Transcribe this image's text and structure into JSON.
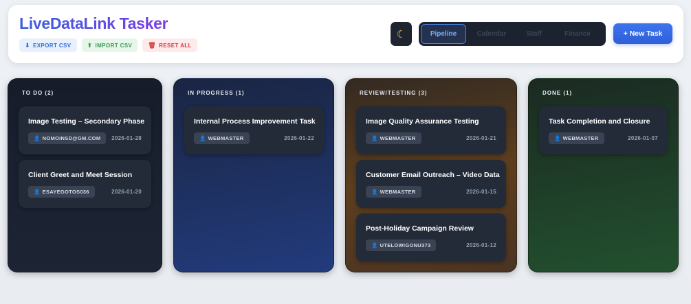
{
  "app": {
    "title": "LiveDataLink Tasker"
  },
  "toolbar": {
    "export": {
      "icon": "download-icon",
      "glyph": "⬇",
      "label": "EXPORT CSV"
    },
    "import": {
      "icon": "upload-icon",
      "glyph": "⬆",
      "label": "IMPORT CSV"
    },
    "reset": {
      "icon": "trash-icon",
      "glyph": "🗑",
      "label": "RESET ALL"
    },
    "theme_glyph": "☾",
    "new_task": "+ New Task"
  },
  "tabs": [
    {
      "label": "Pipeline",
      "active": true
    },
    {
      "label": "Calendar",
      "active": false
    },
    {
      "label": "Staff",
      "active": false
    },
    {
      "label": "Finance",
      "active": false
    }
  ],
  "user_glyph": "👤",
  "columns": [
    {
      "title": "TO DO (2)",
      "cards": [
        {
          "title": "Image Testing – Secondary Phase",
          "assignee": "NOMOINSD@GM.COM",
          "date": "2026-01-28"
        },
        {
          "title": "Client Greet and Meet Session",
          "assignee": "ESAYEGOTOS036",
          "date": "2026-01-20"
        }
      ]
    },
    {
      "title": "IN PROGRESS (1)",
      "cards": [
        {
          "title": "Internal Process Improvement Task",
          "assignee": "WEBMASTER",
          "date": "2026-01-22"
        }
      ]
    },
    {
      "title": "REVIEW/TESTING (3)",
      "cards": [
        {
          "title": "Image Quality Assurance Testing",
          "assignee": "WEBMASTER",
          "date": "2026-01-21"
        },
        {
          "title": "Customer Email Outreach – Video Data",
          "assignee": "WEBMASTER",
          "date": "2026-01-15"
        },
        {
          "title": "Post-Holiday Campaign Review",
          "assignee": "UTELOWIGONU373",
          "date": "2026-01-12"
        }
      ]
    },
    {
      "title": "DONE (1)",
      "cards": [
        {
          "title": "Task Completion and Closure",
          "assignee": "WEBMASTER",
          "date": "2026-01-07"
        }
      ]
    }
  ]
}
